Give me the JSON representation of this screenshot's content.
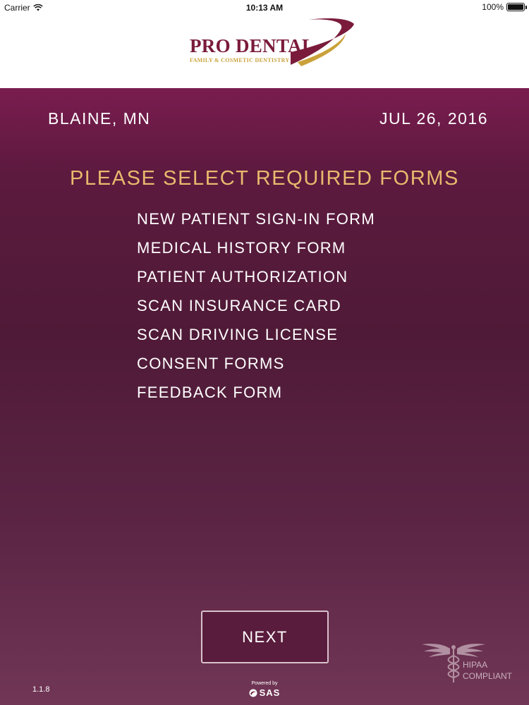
{
  "status_bar": {
    "carrier": "Carrier",
    "time": "10:13 AM",
    "battery": "100%",
    "battery_level": 1.0
  },
  "header": {
    "logo_title": "PRO DENTAL",
    "logo_subtitle": "FAMILY & COSMETIC DENTISTRY"
  },
  "main": {
    "location": "BLAINE, MN",
    "date": "JUL 26, 2016",
    "instructions": "PLEASE SELECT REQUIRED FORMS",
    "forms": [
      "NEW PATIENT SIGN-IN FORM",
      "MEDICAL HISTORY FORM",
      "PATIENT AUTHORIZATION",
      "SCAN INSURANCE CARD",
      "SCAN DRIVING LICENSE",
      "CONSENT FORMS",
      "FEEDBACK FORM"
    ],
    "next_label": "NEXT"
  },
  "footer": {
    "version": "1.1.8",
    "powered_by": "Powered by",
    "powered_brand": "SAS",
    "hipaa_line1": "HIPAA",
    "hipaa_line2": "COMPLIANT"
  },
  "colors": {
    "brand": "#7a1b3c",
    "accent_gold": "#e9b96e",
    "background_top": "#7a1c4f",
    "background_bottom": "#713655"
  }
}
